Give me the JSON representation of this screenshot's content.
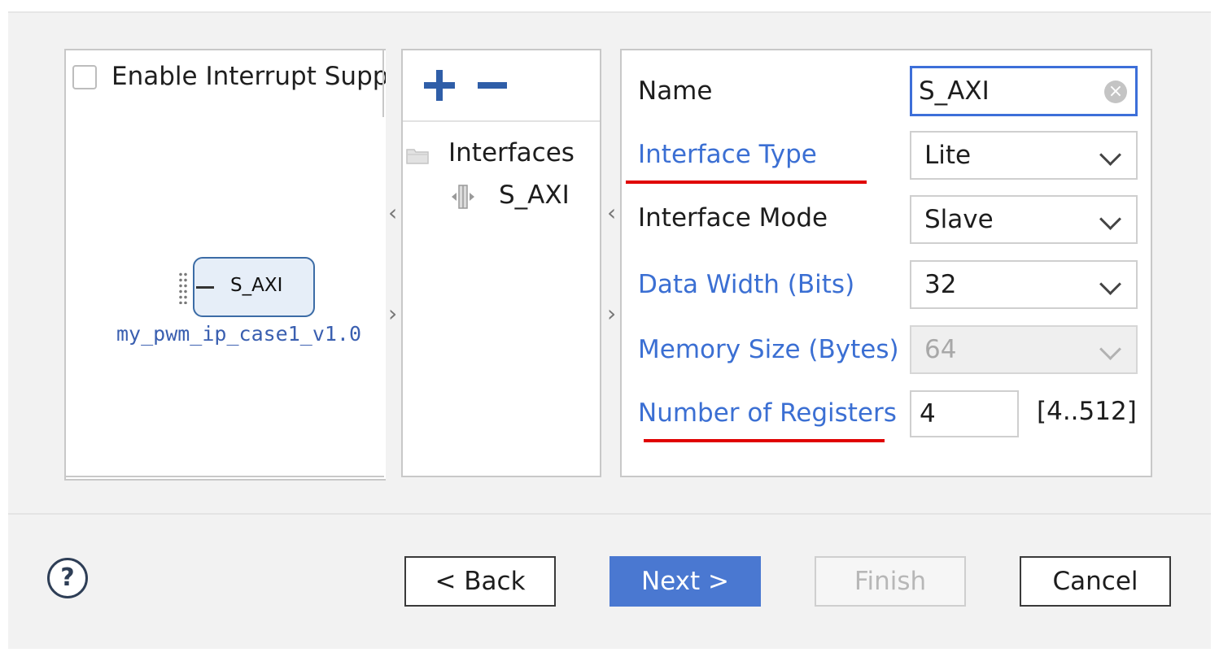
{
  "symbol_panel": {
    "enable_interrupt_label": "Enable Interrupt Supp",
    "port_label": "S_AXI",
    "ip_name": "my_pwm_ip_case1_v1.0"
  },
  "tree_panel": {
    "root_label": "Interfaces",
    "child_label": "S_AXI"
  },
  "properties": {
    "name": {
      "label": "Name",
      "value": "S_AXI"
    },
    "interface_type": {
      "label": "Interface Type",
      "value": "Lite"
    },
    "interface_mode": {
      "label": "Interface Mode",
      "value": "Slave"
    },
    "data_width": {
      "label": "Data Width (Bits)",
      "value": "32"
    },
    "memory_size": {
      "label": "Memory Size (Bytes)",
      "value": "64"
    },
    "num_registers": {
      "label": "Number of Registers",
      "value": "4",
      "range": "[4..512]"
    }
  },
  "footer": {
    "help": "?",
    "back": "< Back",
    "next": "Next >",
    "finish": "Finish",
    "cancel": "Cancel"
  },
  "colors": {
    "link_label": "#3b6fd3",
    "annotation_underline": "#e00000",
    "primary_button": "#4a78d1",
    "focus_border": "#3d6fd9"
  }
}
